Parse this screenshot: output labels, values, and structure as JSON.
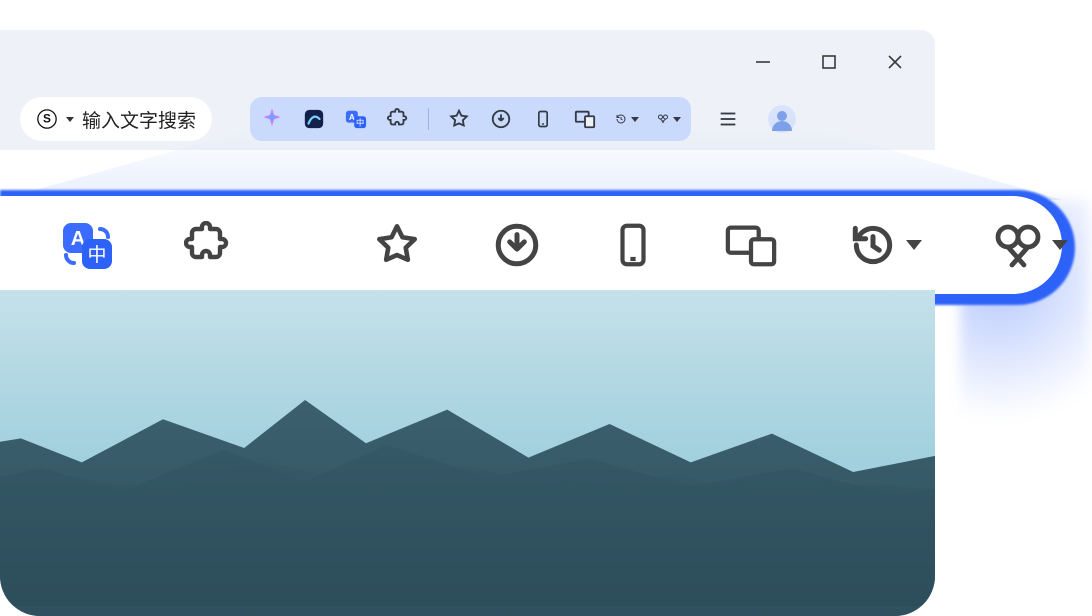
{
  "window": {
    "minimize": "minimize",
    "maximize": "maximize",
    "close": "close"
  },
  "search": {
    "engine_icon": "sogou",
    "placeholder": "输入文字搜索"
  },
  "toolbar": {
    "items": [
      {
        "name": "ai-assistant",
        "has_caret": false
      },
      {
        "name": "sogou-logo",
        "has_caret": false
      },
      {
        "name": "translate",
        "has_caret": false
      },
      {
        "name": "extensions",
        "has_caret": false
      },
      {
        "divider": true
      },
      {
        "name": "favorites",
        "has_caret": false
      },
      {
        "name": "downloads",
        "has_caret": false
      },
      {
        "name": "mobile",
        "has_caret": false
      },
      {
        "name": "multi-screen",
        "has_caret": false
      },
      {
        "name": "history",
        "has_caret": true
      },
      {
        "name": "screenshot",
        "has_caret": true
      }
    ],
    "menu": "menu",
    "profile": "profile"
  },
  "zoomed_toolbar": {
    "items": [
      {
        "name": "translate",
        "active": true,
        "has_caret": false
      },
      {
        "name": "extensions",
        "has_caret": false
      },
      {
        "divider": true
      },
      {
        "name": "favorites",
        "has_caret": false
      },
      {
        "name": "downloads",
        "has_caret": false
      },
      {
        "name": "mobile",
        "has_caret": false
      },
      {
        "name": "multi-screen",
        "has_caret": false
      },
      {
        "name": "history",
        "has_caret": true
      },
      {
        "name": "screenshot",
        "has_caret": true
      }
    ]
  }
}
